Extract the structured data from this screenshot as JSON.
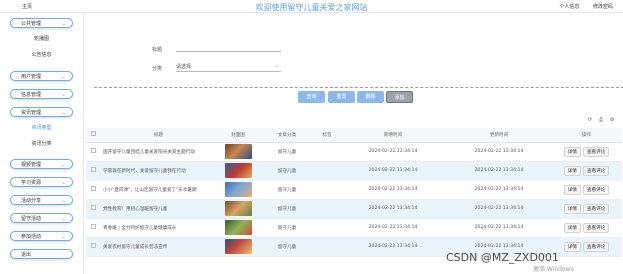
{
  "header": {
    "home_label": "主页",
    "title": "欢迎使用留守儿童关爱之家网站",
    "links": [
      "个人信息",
      "修改密码"
    ]
  },
  "sidebar": {
    "items": [
      {
        "label": "公共管理",
        "type": "group"
      },
      {
        "label": "轮播图",
        "type": "sub"
      },
      {
        "label": "公告信息",
        "type": "sub"
      },
      {
        "label": "用户管理",
        "type": "group"
      },
      {
        "label": "信息管理",
        "type": "group"
      },
      {
        "label": "资讯管理",
        "type": "group"
      },
      {
        "label": "资讯类型",
        "type": "sub",
        "active": true
      },
      {
        "label": "资讯分类",
        "type": "sub"
      },
      {
        "label": "视频管理",
        "type": "group"
      },
      {
        "label": "学习资源",
        "type": "group"
      },
      {
        "label": "活动分享",
        "type": "group"
      },
      {
        "label": "留守活动",
        "type": "group"
      },
      {
        "label": "参加活动",
        "type": "group"
      },
      {
        "label": "退出",
        "type": "group"
      }
    ]
  },
  "search": {
    "title_label": "标题",
    "title_value": "",
    "category_label": "分类",
    "category_value": "请选择"
  },
  "actions": {
    "search": "查询",
    "reset": "重置",
    "delete": "删除",
    "add": "添加"
  },
  "table": {
    "columns": [
      "标题",
      "封面图",
      "文章分类",
      "标签",
      "新增时间",
      "更新时间",
      "操作"
    ],
    "rows": [
      {
        "title": "国开留守儿童团结儿童关爱阳光关爱主题行动",
        "category": "留守儿童",
        "tag": "",
        "created": "2024-02-22 13:34:14",
        "updated": "2024-02-22 13:34:14"
      },
      {
        "title": "学雷锋在新时代，关爱留守儿童我在行动",
        "category": "留守儿童",
        "tag": "",
        "created": "2024-02-22 13:34:14",
        "updated": "2024-02-22 13:34:14"
      },
      {
        "title": "小小\"盘问课\"，让山区留守儿童爱了\"乐享暑期",
        "category": "留守儿童",
        "tag": "",
        "created": "2024-02-22 13:34:14",
        "updated": "2024-02-22 13:34:14"
      },
      {
        "title": "党性教育！用初心温暖留守儿童",
        "category": "留守儿童",
        "tag": "",
        "created": "2024-02-22 13:34:14",
        "updated": "2024-02-22 13:34:14"
      },
      {
        "title": "青春暖 | 全力呵护留守儿童健康成长",
        "category": "留守儿童",
        "tag": "",
        "created": "2024-02-22 13:34:14",
        "updated": "2024-02-22 13:34:14"
      },
      {
        "title": "关爱农村留守儿童成长普法宣传",
        "category": "留守儿童",
        "tag": "",
        "created": "2024-02-22 13:34:14",
        "updated": "2024-02-22 13:34:14"
      }
    ],
    "row_actions": [
      "详情",
      "查看评论"
    ]
  },
  "overlay": {
    "csdn_watermark": "CSDN @MZ_ZXD001",
    "windows_watermark": "激活 Windows"
  },
  "colors": {
    "accent": "#3a8ee6",
    "button": "#8db9ea",
    "stripe": "#eaf4fb"
  }
}
